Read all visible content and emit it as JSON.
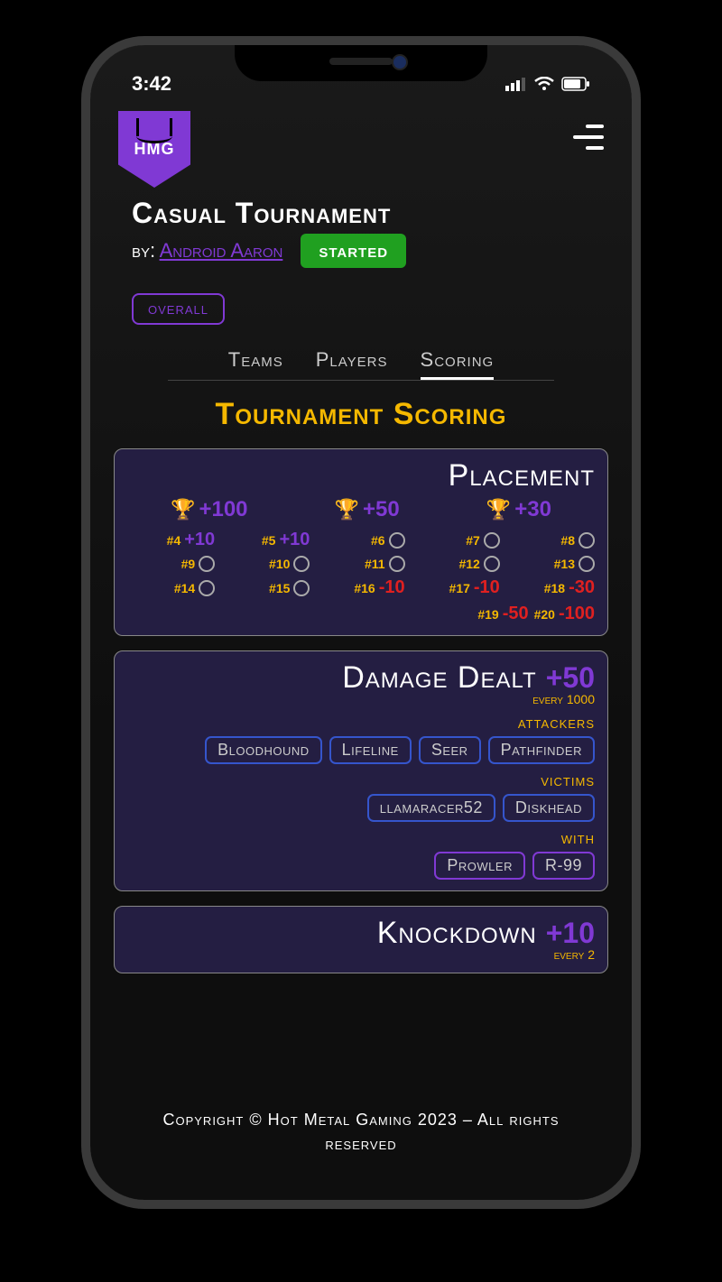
{
  "status_bar": {
    "time": "3:42"
  },
  "logo": {
    "text": "HMG"
  },
  "header": {
    "title": "Casual Tournament",
    "by_label": "by:",
    "author": "Android Aaron",
    "status": "started"
  },
  "overall_label": "overall",
  "tabs": {
    "teams": "Teams",
    "players": "Players",
    "scoring": "Scoring"
  },
  "section_title": "Tournament Scoring",
  "placement": {
    "title": "Placement",
    "trophies": [
      {
        "tier": "gold",
        "pts": "+100"
      },
      {
        "tier": "silver",
        "pts": "+50"
      },
      {
        "tier": "bronze",
        "pts": "+30"
      }
    ],
    "ranks": [
      {
        "n": "#4",
        "v": "+10"
      },
      {
        "n": "#5",
        "v": "+10"
      },
      {
        "n": "#6",
        "v": "0"
      },
      {
        "n": "#7",
        "v": "0"
      },
      {
        "n": "#8",
        "v": "0"
      },
      {
        "n": "#9",
        "v": "0"
      },
      {
        "n": "#10",
        "v": "0"
      },
      {
        "n": "#11",
        "v": "0"
      },
      {
        "n": "#12",
        "v": "0"
      },
      {
        "n": "#13",
        "v": "0"
      },
      {
        "n": "#14",
        "v": "0"
      },
      {
        "n": "#15",
        "v": "0"
      },
      {
        "n": "#16",
        "v": "-10"
      },
      {
        "n": "#17",
        "v": "-10"
      },
      {
        "n": "#18",
        "v": "-30"
      }
    ],
    "tail": [
      {
        "n": "#19",
        "v": "-50"
      },
      {
        "n": "#20",
        "v": "-100"
      }
    ]
  },
  "damage": {
    "title": "Damage Dealt",
    "pts": "+50",
    "every": "every 1000",
    "attackers_label": "attackers",
    "attackers": [
      "Bloodhound",
      "Lifeline",
      "Seer",
      "Pathfinder"
    ],
    "victims_label": "victims",
    "victims": [
      "llamaracer52",
      "Diskhead"
    ],
    "with_label": "with",
    "with": [
      "Prowler",
      "R-99"
    ]
  },
  "knockdown": {
    "title": "Knockdown",
    "pts": "+10",
    "every": "every 2"
  },
  "footer": "Copyright © Hot Metal Gaming 2023 – All rights reserved"
}
